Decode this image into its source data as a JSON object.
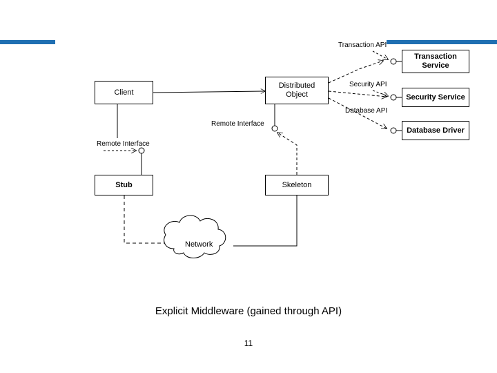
{
  "caption": "Explicit Middleware (gained through API)",
  "page_number": "11",
  "boxes": {
    "client": "Client",
    "dist_obj": "Distributed\nObject",
    "txn_svc": "Transaction\nService",
    "sec_svc": "Security Service",
    "db_drv": "Database Driver",
    "stub": "Stub",
    "skeleton": "Skeleton",
    "network": "Network"
  },
  "labels": {
    "txn_api": "Transaction API",
    "sec_api": "Security API",
    "db_api": "Database API",
    "remote_if_top": "Remote Interface",
    "remote_if_left": "Remote Interface"
  }
}
